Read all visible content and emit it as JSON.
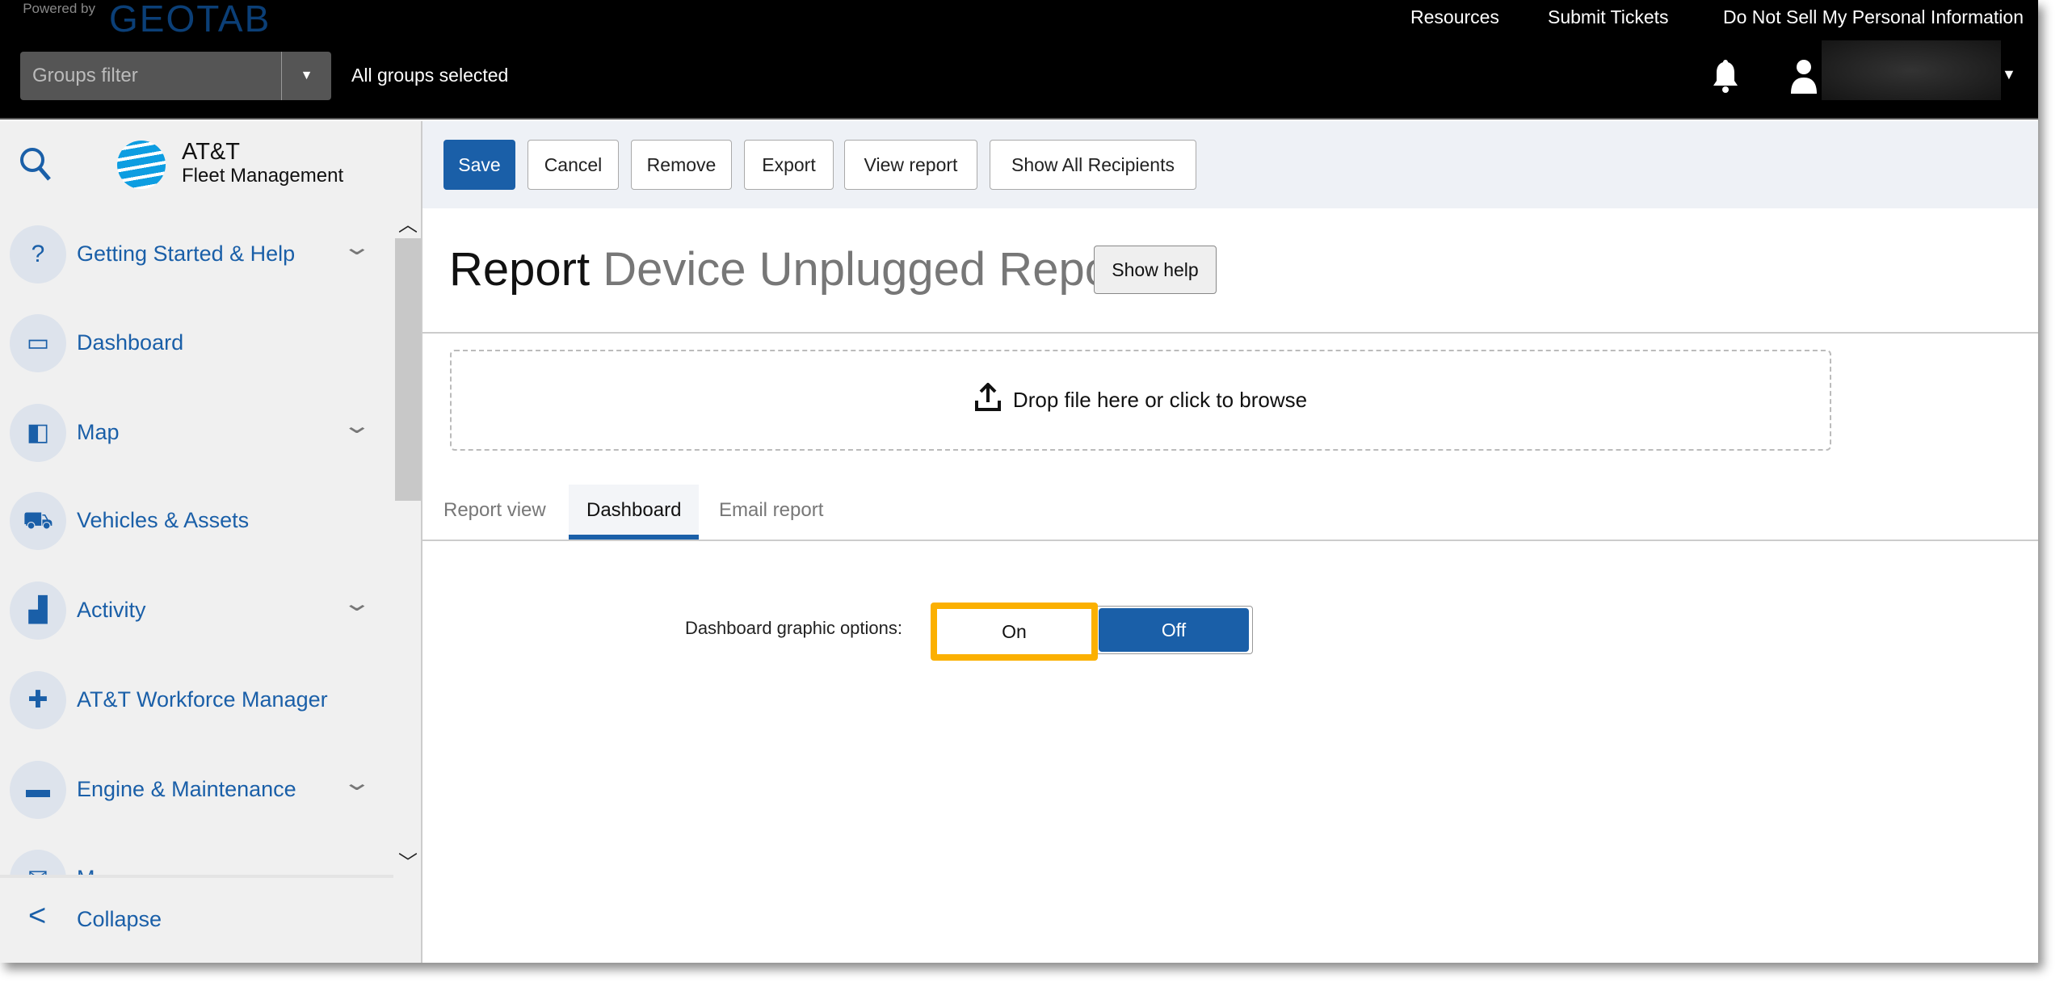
{
  "header": {
    "powered_by": "Powered by",
    "brand": "GEOTAB",
    "groups_filter_placeholder": "Groups filter",
    "groups_status": "All groups selected",
    "links": [
      "Resources",
      "Submit Tickets",
      "Do Not Sell My Personal Information"
    ]
  },
  "sidebar": {
    "logo_line1": "AT&T",
    "logo_line2": "Fleet Management",
    "items": [
      {
        "label": "Getting Started & Help",
        "icon": "help-icon",
        "expandable": true
      },
      {
        "label": "Dashboard",
        "icon": "dashboard-icon",
        "expandable": false
      },
      {
        "label": "Map",
        "icon": "map-icon",
        "expandable": true
      },
      {
        "label": "Vehicles & Assets",
        "icon": "truck-icon",
        "expandable": false
      },
      {
        "label": "Activity",
        "icon": "activity-chart-icon",
        "expandable": true
      },
      {
        "label": "AT&T Workforce Manager",
        "icon": "puzzle-icon",
        "expandable": false
      },
      {
        "label": "Engine & Maintenance",
        "icon": "engine-icon",
        "expandable": true
      },
      {
        "label": "M",
        "icon": "mail-icon",
        "expandable": false
      }
    ],
    "collapse_label": "Collapse"
  },
  "toolbar": {
    "save": "Save",
    "cancel": "Cancel",
    "remove": "Remove",
    "export": "Export",
    "view_report": "View report",
    "show_all_recipients": "Show All Recipients"
  },
  "page": {
    "title_prefix": "Report",
    "title_name": "Device Unplugged Report",
    "show_help": "Show help",
    "dropzone": "Drop file here or click to browse",
    "tabs": [
      "Report view",
      "Dashboard",
      "Email report"
    ],
    "active_tab": "Dashboard",
    "option_label": "Dashboard graphic options:",
    "toggle_on": "On",
    "toggle_off": "Off",
    "toggle_selected": "Off"
  },
  "colors": {
    "accent": "#1a5fa8",
    "highlight": "#fbb000"
  }
}
